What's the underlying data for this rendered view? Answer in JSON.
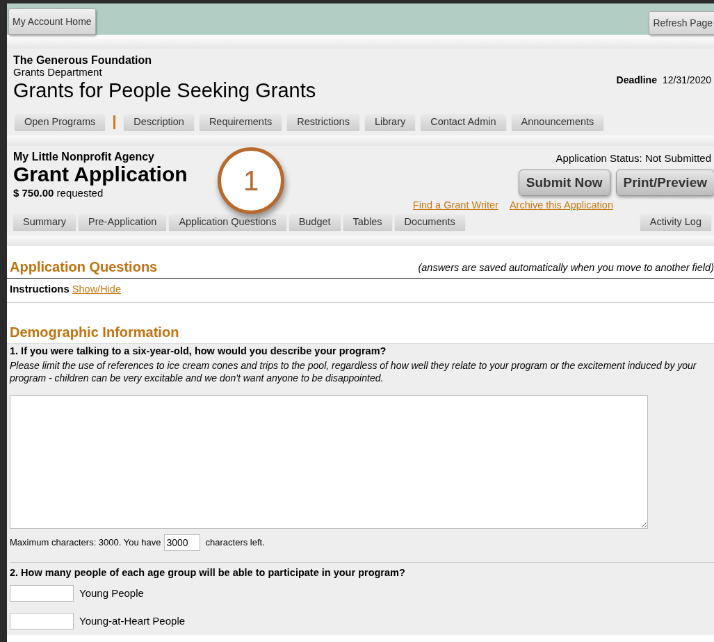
{
  "top_bar": {
    "buttons": [
      {
        "label": "My Account Home"
      },
      {
        "label": "Refresh Page"
      }
    ]
  },
  "program": {
    "organization": "The Generous Foundation",
    "department": "Grants Department",
    "title": "Grants for People Seeking Grants",
    "deadline_label": "Deadline",
    "deadline": "12/31/2020",
    "tabs": [
      {
        "label": "Open Programs"
      },
      {
        "label": "Description"
      },
      {
        "label": "Requirements"
      },
      {
        "label": "Restrictions"
      },
      {
        "label": "Library"
      },
      {
        "label": "Contact Admin"
      },
      {
        "label": "Announcements"
      }
    ]
  },
  "application": {
    "agency": "My Little Nonprofit Agency",
    "title": "Grant Application",
    "amount": "$ 750.00",
    "amount_suffix": "requested",
    "status": "Application Status: Not Submitted",
    "buttons": [
      {
        "label": "Submit Now"
      },
      {
        "label": "Print/Preview"
      }
    ],
    "links": [
      {
        "label": "Find a Grant Writer"
      },
      {
        "label": "Archive this Application"
      }
    ],
    "tabs": [
      {
        "label": "Summary"
      },
      {
        "label": "Pre-Application"
      },
      {
        "label": "Application Questions"
      },
      {
        "label": "Budget"
      },
      {
        "label": "Tables"
      },
      {
        "label": "Documents"
      }
    ],
    "right_tab": {
      "label": "Activity Log"
    },
    "callout": {
      "number": "1"
    }
  },
  "content": {
    "heading": "Application Questions",
    "note": "(answers are saved automatically when you move to another field)",
    "instructions_label": "Instructions",
    "instructions_link": "Show/Hide",
    "section": "Demographic Information",
    "questions": [
      {
        "kind": "textarea",
        "prompt": "1. If you were talking to a six-year-old, how would you describe your program?",
        "help": "Please limit the use of references to ice cream cones and trips to the pool, regardless of how well they relate to your program or the excitement induced by your program - children can be very excitable and we don't want anyone to be disappointed.",
        "counter_before": "Maximum characters: 3000. You have",
        "counter_value": "3000",
        "counter_after": "characters left."
      },
      {
        "kind": "numbers",
        "prompt": "2. How many people of each age group will be able to participate in your program?",
        "fields": [
          {
            "label": "Young People"
          },
          {
            "label": "Young-at-Heart People"
          }
        ]
      }
    ]
  }
}
